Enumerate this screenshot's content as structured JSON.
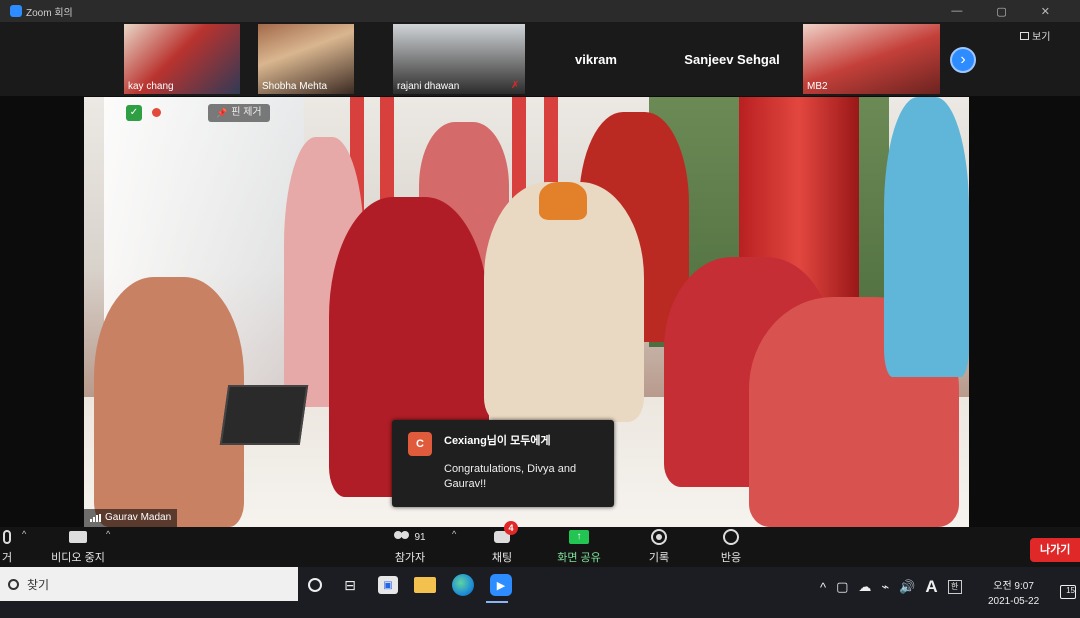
{
  "window": {
    "title": "Zoom 회의"
  },
  "gallery": {
    "tiles": [
      {
        "name": "kay chang"
      },
      {
        "name": "Shobha Mehta"
      },
      {
        "name": "rajani dhawan"
      },
      {
        "name": "vikram"
      },
      {
        "name": "Sanjeev Sehgal"
      },
      {
        "name": "MB2"
      }
    ],
    "view_label": "보기"
  },
  "main_video": {
    "unpin_label": "핀 제거",
    "speaker_name": "Gaurav Madan"
  },
  "chat_popup": {
    "avatar_letter": "C",
    "sender": "Cexiang님이 모두에게",
    "message": "Congratulations, Divya and Gaurav!!"
  },
  "toolbar": {
    "mute_label": "거",
    "video_label": "비디오 중지",
    "participants_label": "참가자",
    "participants_count": "91",
    "chat_label": "채팅",
    "chat_badge": "4",
    "share_label": "화면 공유",
    "record_label": "기록",
    "reactions_label": "반응",
    "leave_label": "나가기"
  },
  "taskbar": {
    "search_placeholder": "찾기",
    "ime_label": "한",
    "lang_label": "A",
    "time": "오전 9:07",
    "date": "2021-05-22",
    "notification_count": "15"
  }
}
